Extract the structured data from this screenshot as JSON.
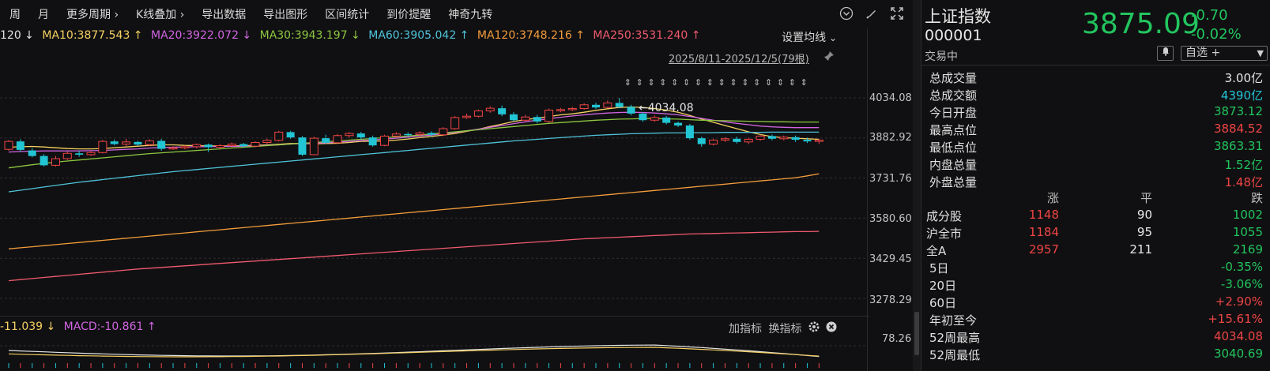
{
  "toolbar": {
    "items": [
      "周",
      "月",
      "更多周期 ›",
      "K线叠加 ›",
      "导出数据",
      "导出图形",
      "区间统计",
      "到价提醒",
      "神奇九转"
    ]
  },
  "ma_legend": {
    "items": [
      {
        "text": "120 ↓",
        "color": "#e0e0e0"
      },
      {
        "text": "MA10:3877.543 ↑",
        "color": "#f5d061"
      },
      {
        "text": "MA20:3922.072 ↓",
        "color": "#d065e0"
      },
      {
        "text": "MA30:3943.197 ↓",
        "color": "#8cc63f"
      },
      {
        "text": "MA60:3905.042 ↑",
        "color": "#4fc3d9"
      },
      {
        "text": "MA120:3748.216 ↑",
        "color": "#f39c3a"
      },
      {
        "text": "MA250:3531.240 ↑",
        "color": "#f05a6e"
      }
    ],
    "settings_label": "设置均线"
  },
  "range_label": "2025/8/11-2025/12/5(79根)",
  "high_marker": "4034.08",
  "price_axis": [
    "4034.08",
    "3882.92",
    "3731.76",
    "3580.60",
    "3429.45",
    "3278.29"
  ],
  "sub_chart": {
    "legend_left": "-11.039 ↓",
    "legend_macd": "MACD:-10.861 ↑",
    "add_indicator": "加指标",
    "switch_indicator": "换指标",
    "axis_value": "78.26"
  },
  "chart_data": {
    "type": "candlestick",
    "ylim": [
      3200,
      4100
    ],
    "up_color": "#ef4444",
    "down_color": "#22c5d4",
    "candles": [
      [
        3840,
        3870,
        3835,
        3875
      ],
      [
        3870,
        3838,
        3830,
        3878
      ],
      [
        3836,
        3815,
        3810,
        3845
      ],
      [
        3815,
        3780,
        3775,
        3822
      ],
      [
        3780,
        3805,
        3775,
        3815
      ],
      [
        3805,
        3825,
        3800,
        3832
      ],
      [
        3825,
        3820,
        3812,
        3835
      ],
      [
        3820,
        3828,
        3815,
        3835
      ],
      [
        3828,
        3870,
        3825,
        3876
      ],
      [
        3870,
        3860,
        3855,
        3877
      ],
      [
        3860,
        3868,
        3852,
        3880
      ],
      [
        3868,
        3858,
        3852,
        3872
      ],
      [
        3858,
        3872,
        3852,
        3878
      ],
      [
        3872,
        3842,
        3835,
        3880
      ],
      [
        3842,
        3846,
        3838,
        3852
      ],
      [
        3846,
        3850,
        3840,
        3856
      ],
      [
        3850,
        3858,
        3844,
        3862
      ],
      [
        3858,
        3848,
        3830,
        3862
      ],
      [
        3848,
        3854,
        3842,
        3860
      ],
      [
        3854,
        3860,
        3848,
        3866
      ],
      [
        3860,
        3852,
        3846,
        3864
      ],
      [
        3852,
        3866,
        3848,
        3870
      ],
      [
        3866,
        3874,
        3860,
        3880
      ],
      [
        3874,
        3905,
        3870,
        3910
      ],
      [
        3905,
        3885,
        3880,
        3910
      ],
      [
        3885,
        3820,
        3815,
        3890
      ],
      [
        3820,
        3882,
        3818,
        3888
      ],
      [
        3882,
        3865,
        3860,
        3895
      ],
      [
        3865,
        3892,
        3862,
        3898
      ],
      [
        3892,
        3900,
        3884,
        3905
      ],
      [
        3900,
        3885,
        3878,
        3906
      ],
      [
        3885,
        3855,
        3850,
        3892
      ],
      [
        3855,
        3890,
        3852,
        3895
      ],
      [
        3890,
        3898,
        3884,
        3905
      ],
      [
        3898,
        3896,
        3888,
        3904
      ],
      [
        3896,
        3902,
        3890,
        3908
      ],
      [
        3902,
        3895,
        3888,
        3908
      ],
      [
        3895,
        3918,
        3890,
        3924
      ],
      [
        3918,
        3960,
        3914,
        3966
      ],
      [
        3960,
        3965,
        3955,
        3975
      ],
      [
        3965,
        3985,
        3960,
        3990
      ],
      [
        3985,
        3995,
        3978,
        4002
      ],
      [
        3995,
        3972,
        3965,
        4005
      ],
      [
        3972,
        3950,
        3945,
        3980
      ],
      [
        3950,
        3962,
        3944,
        3970
      ],
      [
        3962,
        3945,
        3938,
        3970
      ],
      [
        3945,
        3988,
        3940,
        3994
      ],
      [
        3988,
        3990,
        3980,
        3996
      ],
      [
        3990,
        3994,
        3984,
        4000
      ],
      [
        3994,
        4008,
        3990,
        4014
      ],
      [
        4008,
        3998,
        3992,
        4016
      ],
      [
        3998,
        4015,
        3994,
        4024
      ],
      [
        4015,
        4000,
        3995,
        4034
      ],
      [
        4000,
        3975,
        3968,
        4008
      ],
      [
        3975,
        3950,
        3944,
        3980
      ],
      [
        3950,
        3960,
        3944,
        3968
      ],
      [
        3960,
        3940,
        3934,
        3966
      ],
      [
        3940,
        3930,
        3924,
        3945
      ],
      [
        3930,
        3882,
        3876,
        3936
      ],
      [
        3882,
        3860,
        3850,
        3888
      ],
      [
        3860,
        3875,
        3855,
        3880
      ],
      [
        3875,
        3880,
        3868,
        3886
      ],
      [
        3880,
        3868,
        3862,
        3888
      ],
      [
        3868,
        3878,
        3860,
        3884
      ],
      [
        3878,
        3890,
        3872,
        3896
      ],
      [
        3890,
        3880,
        3874,
        3896
      ],
      [
        3880,
        3886,
        3874,
        3892
      ],
      [
        3886,
        3876,
        3868,
        3892
      ],
      [
        3876,
        3870,
        3864,
        3884
      ],
      [
        3870,
        3875,
        3860,
        3880
      ]
    ],
    "series": [
      {
        "name": "MA10",
        "color": "#f5d061",
        "values": [
          3848,
          3850,
          3851,
          3849,
          3846,
          3843,
          3842,
          3842,
          3843,
          3846,
          3849,
          3852,
          3855,
          3857,
          3857,
          3855,
          3854,
          3853,
          3853,
          3853,
          3854,
          3855,
          3857,
          3859,
          3862,
          3862,
          3861,
          3862,
          3863,
          3866,
          3870,
          3871,
          3872,
          3875,
          3879,
          3884,
          3889,
          3894,
          3900,
          3908,
          3916,
          3926,
          3935,
          3945,
          3952,
          3958,
          3964,
          3970,
          3974,
          3980,
          3987,
          3993,
          3998,
          4000,
          3998,
          3994,
          3988,
          3980,
          3968,
          3954,
          3942,
          3930,
          3918,
          3906,
          3896,
          3888,
          3884,
          3882,
          3880,
          3878
        ]
      },
      {
        "name": "MA20",
        "color": "#d065e0",
        "values": [
          3830,
          3832,
          3833,
          3834,
          3834,
          3834,
          3834,
          3835,
          3836,
          3838,
          3840,
          3842,
          3845,
          3847,
          3848,
          3849,
          3850,
          3850,
          3851,
          3851,
          3852,
          3853,
          3855,
          3857,
          3860,
          3862,
          3863,
          3865,
          3867,
          3870,
          3873,
          3876,
          3879,
          3882,
          3886,
          3890,
          3894,
          3899,
          3904,
          3910,
          3916,
          3923,
          3930,
          3937,
          3944,
          3950,
          3956,
          3961,
          3966,
          3970,
          3974,
          3977,
          3979,
          3980,
          3979,
          3977,
          3974,
          3970,
          3964,
          3957,
          3950,
          3944,
          3938,
          3933,
          3928,
          3925,
          3923,
          3922,
          3922,
          3922
        ]
      },
      {
        "name": "MA30",
        "color": "#8cc63f",
        "values": [
          3770,
          3776,
          3782,
          3787,
          3792,
          3796,
          3800,
          3804,
          3808,
          3812,
          3816,
          3820,
          3824,
          3827,
          3830,
          3833,
          3836,
          3839,
          3842,
          3845,
          3848,
          3851,
          3854,
          3857,
          3860,
          3863,
          3866,
          3869,
          3872,
          3875,
          3878,
          3881,
          3884,
          3887,
          3890,
          3894,
          3898,
          3902,
          3906,
          3910,
          3914,
          3918,
          3922,
          3926,
          3930,
          3934,
          3938,
          3941,
          3944,
          3947,
          3950,
          3952,
          3954,
          3955,
          3956,
          3956,
          3955,
          3954,
          3952,
          3950,
          3949,
          3948,
          3947,
          3946,
          3945,
          3944,
          3944,
          3943,
          3943,
          3943
        ]
      },
      {
        "name": "MA60",
        "color": "#4fc3d9",
        "values": [
          3680,
          3686,
          3692,
          3698,
          3704,
          3710,
          3716,
          3721,
          3726,
          3731,
          3736,
          3741,
          3746,
          3751,
          3756,
          3760,
          3764,
          3768,
          3772,
          3776,
          3780,
          3784,
          3788,
          3792,
          3796,
          3800,
          3804,
          3808,
          3812,
          3816,
          3820,
          3824,
          3828,
          3832,
          3836,
          3840,
          3844,
          3848,
          3852,
          3856,
          3860,
          3864,
          3868,
          3872,
          3875,
          3878,
          3881,
          3884,
          3887,
          3890,
          3893,
          3895,
          3897,
          3899,
          3900,
          3901,
          3902,
          3902,
          3903,
          3903,
          3903,
          3904,
          3904,
          3904,
          3904,
          3905,
          3905,
          3905,
          3905,
          3905
        ]
      },
      {
        "name": "MA120",
        "color": "#f39c3a",
        "values": [
          3465,
          3469,
          3473,
          3477,
          3481,
          3485,
          3489,
          3493,
          3497,
          3501,
          3505,
          3509,
          3513,
          3517,
          3521,
          3525,
          3529,
          3533,
          3537,
          3541,
          3545,
          3549,
          3553,
          3557,
          3561,
          3565,
          3569,
          3573,
          3577,
          3581,
          3585,
          3589,
          3593,
          3597,
          3601,
          3605,
          3609,
          3613,
          3617,
          3621,
          3625,
          3629,
          3633,
          3637,
          3641,
          3645,
          3649,
          3653,
          3657,
          3661,
          3665,
          3669,
          3673,
          3677,
          3681,
          3685,
          3689,
          3693,
          3697,
          3701,
          3705,
          3709,
          3713,
          3717,
          3721,
          3725,
          3729,
          3733,
          3740,
          3748
        ]
      },
      {
        "name": "MA250",
        "color": "#f05a6e",
        "values": [
          3345,
          3349,
          3353,
          3357,
          3361,
          3365,
          3369,
          3373,
          3377,
          3381,
          3385,
          3389,
          3392,
          3395,
          3398,
          3401,
          3404,
          3407,
          3410,
          3413,
          3416,
          3419,
          3422,
          3425,
          3428,
          3431,
          3434,
          3437,
          3440,
          3443,
          3446,
          3449,
          3452,
          3455,
          3458,
          3461,
          3464,
          3467,
          3470,
          3473,
          3476,
          3479,
          3482,
          3485,
          3488,
          3491,
          3494,
          3497,
          3500,
          3503,
          3505,
          3507,
          3509,
          3511,
          3513,
          3515,
          3517,
          3519,
          3521,
          3522,
          3523,
          3524,
          3525,
          3526,
          3527,
          3528,
          3529,
          3530,
          3530,
          3531
        ]
      }
    ]
  },
  "panel": {
    "name": "上证指数",
    "code": "000001",
    "state": "交易中",
    "price": "3875.09",
    "change": "-0.70",
    "change_pct": "-0.02%",
    "watch_label": "自选 +",
    "stats": [
      {
        "label": "总成交量",
        "value": "3.00亿",
        "cls": "white"
      },
      {
        "label": "总成交额",
        "value": "4390亿",
        "cls": "cyan"
      },
      {
        "label": "今日开盘",
        "value": "3873.12",
        "cls": "green"
      },
      {
        "label": "最高点位",
        "value": "3884.52",
        "cls": "red"
      },
      {
        "label": "最低点位",
        "value": "3863.31",
        "cls": "green"
      },
      {
        "label": "内盘总量",
        "value": "1.52亿",
        "cls": "green"
      },
      {
        "label": "外盘总量",
        "value": "1.48亿",
        "cls": "red"
      }
    ],
    "breadth_head": {
      "up": "涨",
      "flat": "平",
      "down": "跌"
    },
    "breadth": [
      {
        "label": "成分股",
        "up": "1148",
        "flat": "90",
        "down": "1002"
      },
      {
        "label": "沪全市",
        "up": "1184",
        "flat": "95",
        "down": "1055"
      },
      {
        "label": "全A",
        "up": "2957",
        "flat": "211",
        "down": "2169"
      }
    ],
    "perf": [
      {
        "label": "5日",
        "value": "-0.35%",
        "cls": "green"
      },
      {
        "label": "20日",
        "value": "-3.06%",
        "cls": "green"
      },
      {
        "label": "60日",
        "value": "+2.90%",
        "cls": "red"
      },
      {
        "label": "年初至今",
        "value": "+15.61%",
        "cls": "red"
      },
      {
        "label": "52周最高",
        "value": "4034.08",
        "cls": "red"
      },
      {
        "label": "52周最低",
        "value": "3040.69",
        "cls": "green"
      }
    ]
  }
}
